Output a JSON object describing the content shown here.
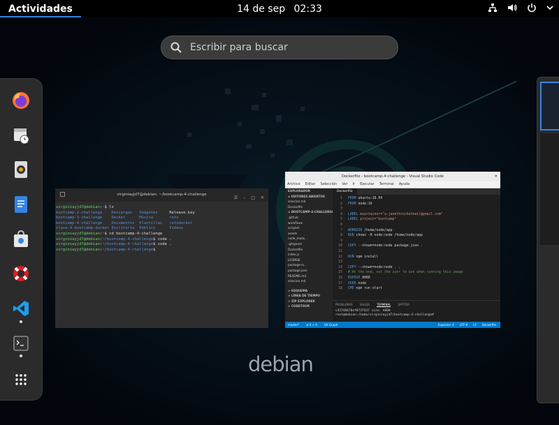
{
  "topbar": {
    "activities": "Actividades",
    "date": "14 de sep",
    "time": "02:33",
    "icons": [
      "network-icon",
      "volume-icon",
      "power-icon",
      "chevron-down-icon"
    ]
  },
  "search": {
    "placeholder": "Escribir para buscar"
  },
  "dash": {
    "apps": [
      {
        "name": "Firefox",
        "icon": "firefox-icon",
        "running": false
      },
      {
        "name": "Evolution",
        "icon": "mail-calendar-icon",
        "running": false
      },
      {
        "name": "Rhythmbox",
        "icon": "speaker-icon",
        "running": false
      },
      {
        "name": "Documentos",
        "icon": "document-icon",
        "running": false
      },
      {
        "name": "Software",
        "icon": "software-bag-icon",
        "running": false
      },
      {
        "name": "Ayuda",
        "icon": "lifebuoy-icon",
        "running": false
      },
      {
        "name": "Visual Studio Code",
        "icon": "vscode-icon",
        "running": true
      },
      {
        "name": "Terminal",
        "icon": "terminal-icon",
        "running": true
      },
      {
        "name": "Mostrar aplicaciones",
        "icon": "app-grid-icon",
        "running": false
      }
    ]
  },
  "terminal": {
    "title": "virginiayjd7@debian: ~/bootcamp-4-challenge",
    "prompt_user": "virginiayjd7@debian",
    "lines": [
      {
        "path": "~",
        "cmd": "$ ls"
      },
      {
        "ls": [
          "bootcamp-2-challenge",
          "Descargas",
          "Imágenes",
          "Release.key"
        ]
      },
      {
        "ls": [
          "bootcamp-3-challenge",
          "Docker",
          "Música",
          "reto"
        ]
      },
      {
        "ls": [
          "bootcamp-4-challenge",
          "Documentos",
          "Plantillas",
          "retodocker"
        ]
      },
      {
        "ls": [
          "clase-4-bootcamp-docker",
          "Escritorio",
          "Público",
          "Vídeos"
        ]
      },
      {
        "path": "~",
        "cmd": "$ cd bootcamp-4-challenge"
      },
      {
        "path": "~/bootcamp-4-challenge",
        "cmd": "$ code ."
      },
      {
        "path": "~/bootcamp-4-challenge",
        "cmd": "$ code ."
      },
      {
        "path": "~/bootcamp-4-challenge",
        "cmd": "$ "
      }
    ]
  },
  "vscode": {
    "title": "Dockerfile - bootcamp-4-challenge - Visual Studio Code",
    "menu": [
      "Archivo",
      "Editar",
      "Selección",
      "Ver",
      "Ir",
      "Ejecutar",
      "Terminal",
      "Ayuda"
    ],
    "sidebar": {
      "header": "EXPLORADOR",
      "open_editors": "EDITORES ABIERTOS",
      "open_files": [
        "solucion.md",
        "Dockerfile"
      ],
      "project": "BOOTCAMP-4-CHALLENGE",
      "files": [
        ".github",
        "workflows",
        "scriptsh",
        "assets",
        "node_mods...",
        ".gitignore",
        "Dockerfile",
        "index.js",
        "LICENSE",
        "package-lo...",
        "package.json",
        "README.md",
        "solucion.md"
      ],
      "bottom": [
        "ESQUEMA",
        "LÍNEA DE TIEMPO",
        "ZIP EXPLORER",
        "CODETOUR"
      ]
    },
    "tab": "Dockerfile",
    "code": [
      {
        "n": "1",
        "kw": "FROM",
        "rest": " ubuntu:18.04"
      },
      {
        "n": "2",
        "kw": "FROM",
        "rest": " node:16"
      },
      {
        "n": "3",
        "kw": "",
        "rest": ""
      },
      {
        "n": "4",
        "kw": "LABEL",
        "rest": " maintainer=\"a.janethrocketmail@gmail.com\""
      },
      {
        "n": "5",
        "kw": "LABEL",
        "rest": " project=\"bootcamp\""
      },
      {
        "n": "6",
        "kw": "",
        "rest": ""
      },
      {
        "n": "7",
        "kw": "WORKDIR",
        "rest": " /home/node/app"
      },
      {
        "n": "8",
        "kw": "RUN",
        "rest": " chown -R node:node /home/node/app"
      },
      {
        "n": "9",
        "kw": "",
        "rest": ""
      },
      {
        "n": "10",
        "kw": "COPY",
        "rest": " --chown=node:node package.json ."
      },
      {
        "n": "11",
        "kw": "",
        "rest": ""
      },
      {
        "n": "12",
        "kw": "RUN",
        "rest": " npm install"
      },
      {
        "n": "13",
        "kw": "",
        "rest": ""
      },
      {
        "n": "14",
        "kw": "COPY",
        "rest": " --chown=node:node . ."
      },
      {
        "n": "15",
        "kw": "",
        "rest": "# At the end, set the user to use when running this image"
      },
      {
        "n": "16",
        "kw": "EXPOSE",
        "rest": " 8080"
      },
      {
        "n": "17",
        "kw": "USER",
        "rest": " node"
      },
      {
        "n": "18",
        "kw": "CMD",
        "rest": " npm run start"
      }
    ],
    "panel_tabs": [
      "PROBLEMAS",
      "SALIDA",
      "TERMINAL",
      "JUPYTER"
    ],
    "panel_active": "TERMINAL",
    "panel_lines": [
      "c43746670ef0737437 size: 4800",
      "root@debian:/home/virginiayjd7/bootcamp-4-challenge# "
    ],
    "status_left": [
      "master*",
      "⊗ 0 ⚠ 0",
      "Git Graph"
    ],
    "status_right": [
      "Espacios: 4",
      "UTF-8",
      "LF",
      "Dockerfile"
    ]
  },
  "wallpaper": {
    "logo": "debian"
  }
}
